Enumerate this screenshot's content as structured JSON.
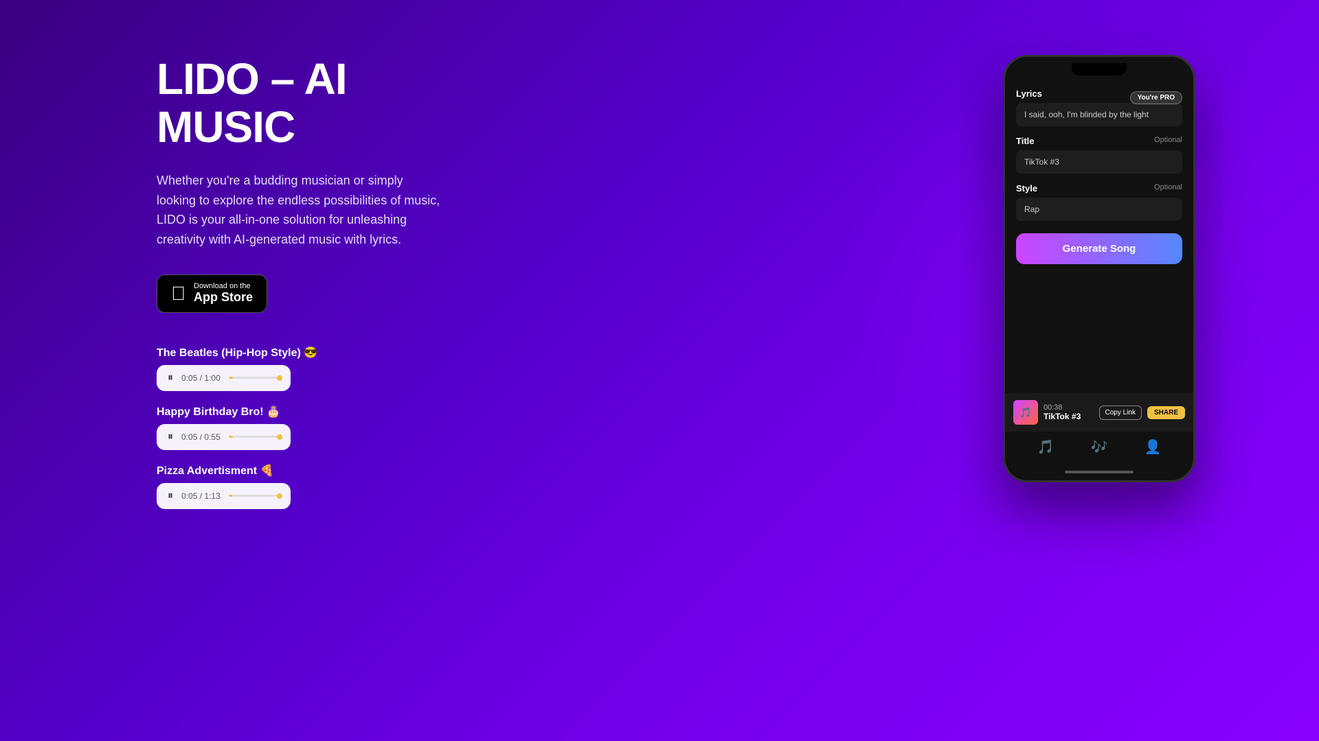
{
  "hero": {
    "title_line1": "LIDO – AI",
    "title_line2": "MUSIC",
    "description": "Whether you're a budding musician or simply looking to explore the endless possibilities of music, LIDO is your all-in-one solution for unleashing creativity with AI-generated music with lyrics."
  },
  "appstore": {
    "download_text": "Download on the",
    "store_name": "App Store"
  },
  "songs": [
    {
      "title": "The Beatles (Hip-Hop Style) 😎",
      "current_time": "0:05",
      "total_time": "1:00",
      "progress": 8
    },
    {
      "title": "Happy Birthday Bro! 🎂",
      "current_time": "0:05",
      "total_time": "0:55",
      "progress": 9
    },
    {
      "title": "Pizza Advertisment 🍕",
      "current_time": "0:05",
      "total_time": "1:13",
      "progress": 7
    }
  ],
  "phone": {
    "pro_badge": "You're PRO",
    "lyrics_label": "Lyrics",
    "lyrics_value": "I said, ooh, I'm blinded by the light",
    "title_label": "Title",
    "title_optional": "Optional",
    "title_value": "TikTok #3",
    "style_label": "Style",
    "style_optional": "Optional",
    "style_value": "Rap",
    "generate_btn": "Generate Song",
    "player_time": "00:38",
    "player_song": "TikTok #3",
    "copy_link_btn": "Copy Link",
    "share_btn": "SHARE"
  }
}
